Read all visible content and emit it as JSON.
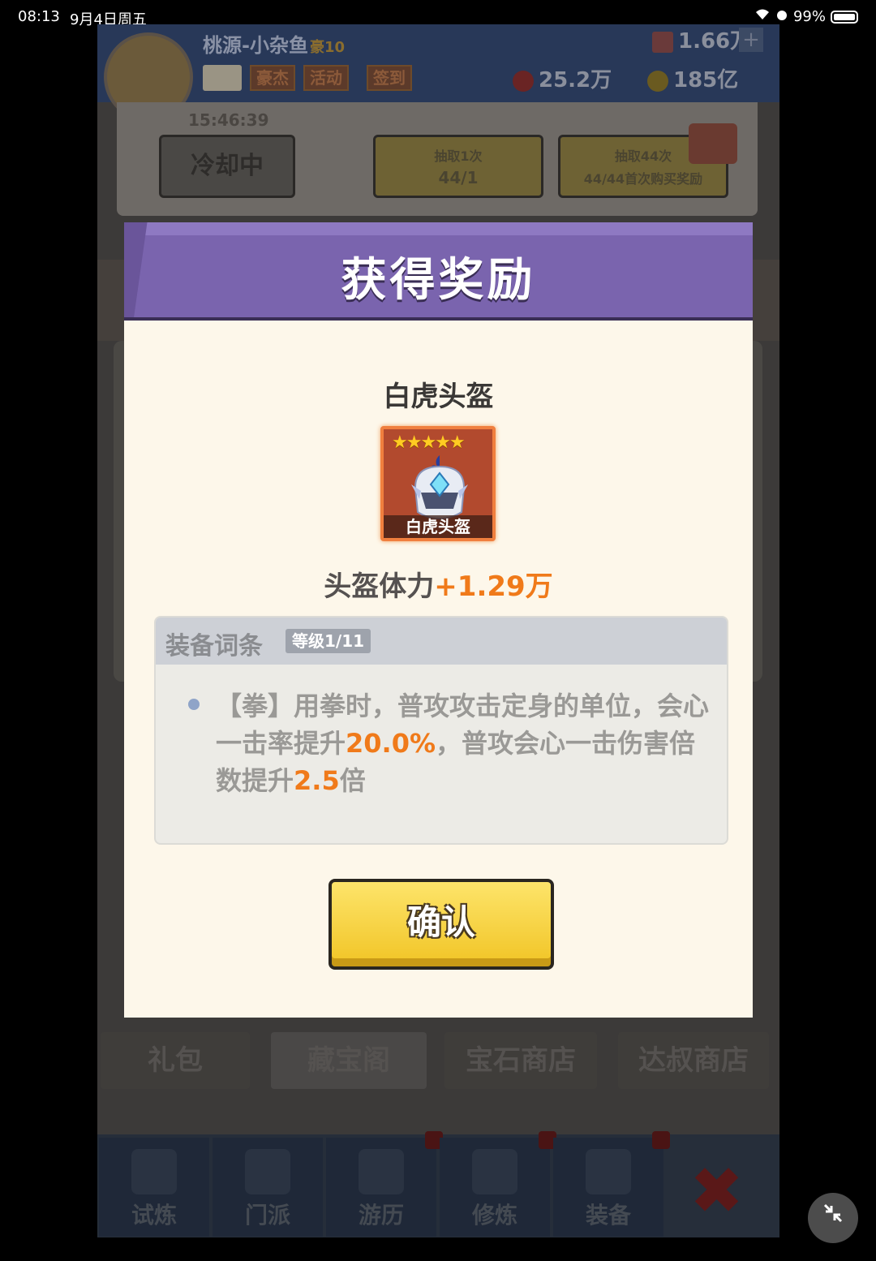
{
  "status_bar": {
    "time": "08:13",
    "date": "9月4日周五",
    "battery": "99%"
  },
  "game": {
    "player_name": "桃源-小杂鱼",
    "vip": "豪10",
    "tags": [
      "豪杰",
      "活动",
      "签到"
    ],
    "resources": {
      "gem": "1.66万",
      "red": "25.2万",
      "gold": "185亿"
    },
    "timer": "15:46:39",
    "cooldown_label": "冷却中",
    "draw_once": {
      "title": "抽取1次",
      "cost": "44/1"
    },
    "draw_many": {
      "title": "抽取44次",
      "cost": "44/44首次购买奖励"
    },
    "shop_tabs": [
      "礼包",
      "藏宝阁",
      "宝石商店",
      "达叔商店"
    ],
    "nav": [
      "试炼",
      "门派",
      "游历",
      "修炼",
      "装备"
    ]
  },
  "modal": {
    "title": "获得奖励",
    "item_name": "白虎头盔",
    "stars": "★★★★★",
    "card_label": "白虎头盔",
    "stat_label": "头盔体力",
    "stat_value": "+1.29万",
    "affix_title": "装备词条",
    "affix_level": "等级1/11",
    "affix_part1": "【拳】用拳时，普攻攻击定身的单位，会心一击率提升",
    "affix_hl1": "20.0%",
    "affix_part2": "，普攻会心一击伤害倍数提升",
    "affix_hl2": "2.5",
    "affix_part3": "倍",
    "confirm_label": "确认"
  },
  "colors": {
    "header_purple": "#7a64ae",
    "accent_orange": "#f07a1a",
    "confirm_yellow": "#f1c425"
  }
}
